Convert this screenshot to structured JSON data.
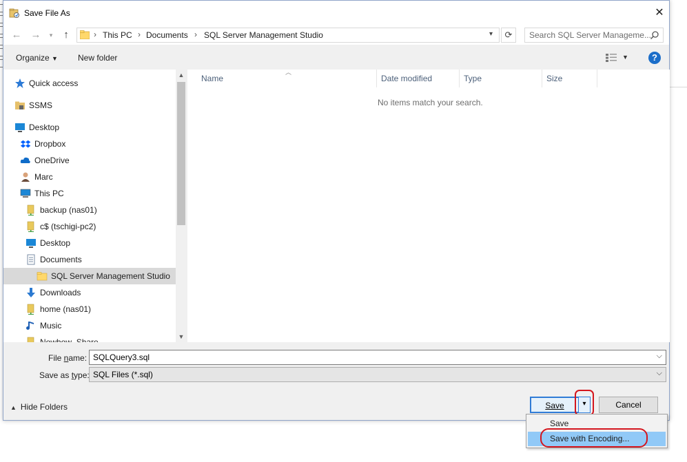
{
  "window": {
    "title": "Save File As",
    "close": "✕"
  },
  "address": {
    "crumbs": [
      "This PC",
      "Documents",
      "SQL Server Management Studio"
    ],
    "search_placeholder": "Search SQL Server Manageme..."
  },
  "toolbar": {
    "organize": "Organize",
    "new_folder": "New folder"
  },
  "nav_pane": {
    "items": [
      {
        "label": "Quick access",
        "icon": "star-icon",
        "color": "#2c7ad6"
      },
      {
        "label": "SSMS",
        "icon": "folder-tool-icon",
        "color": "#e6c06a"
      },
      {
        "label": "Desktop",
        "icon": "desktop-icon",
        "color": "#1b87d6"
      },
      {
        "label": "Dropbox",
        "icon": "dropbox-icon",
        "color": "#0061fe"
      },
      {
        "label": "OneDrive",
        "icon": "cloud-icon",
        "color": "#0f6cc9"
      },
      {
        "label": "Marc",
        "icon": "user-icon",
        "color": "#6b4c3b"
      },
      {
        "label": "This PC",
        "icon": "computer-icon",
        "color": "#1b87d6"
      },
      {
        "label": "backup (nas01)",
        "icon": "network-drive-icon",
        "color": "#e9c95c"
      },
      {
        "label": "c$ (tschigi-pc2)",
        "icon": "network-drive-icon",
        "color": "#e9c95c"
      },
      {
        "label": "Desktop",
        "icon": "desktop-icon",
        "color": "#1b87d6"
      },
      {
        "label": "Documents",
        "icon": "document-icon",
        "color": "#7b8ea6"
      },
      {
        "label": "SQL Server Management Studio",
        "icon": "folder-icon",
        "color": "#ffd86b"
      },
      {
        "label": "Downloads",
        "icon": "download-icon",
        "color": "#2b7ad1"
      },
      {
        "label": "home (nas01)",
        "icon": "network-drive-icon",
        "color": "#e9c95c"
      },
      {
        "label": "Music",
        "icon": "music-icon",
        "color": "#1d5fb5"
      },
      {
        "label": "Nowhow_Share",
        "icon": "network-drive-icon",
        "color": "#e9c95c"
      }
    ],
    "selected_index": 11
  },
  "file_list": {
    "columns": [
      "Name",
      "Date modified",
      "Type",
      "Size"
    ],
    "empty_message": "No items match your search."
  },
  "fields": {
    "file_name_label": "File name:",
    "file_name_value": "SQLQuery3.sql",
    "type_label": "Save as type:",
    "type_value": "SQL Files (*.sql)"
  },
  "buttons": {
    "hide_folders": "Hide Folders",
    "save": "Save",
    "cancel": "Cancel",
    "split_arrow": "▾"
  },
  "save_menu": {
    "items": [
      "Save",
      "Save with Encoding..."
    ],
    "highlighted_index": 1
  },
  "colors": {
    "accent": "#2f7bd6",
    "highlight_annotation": "#d4151d",
    "menu_hover": "#91c9f7"
  }
}
